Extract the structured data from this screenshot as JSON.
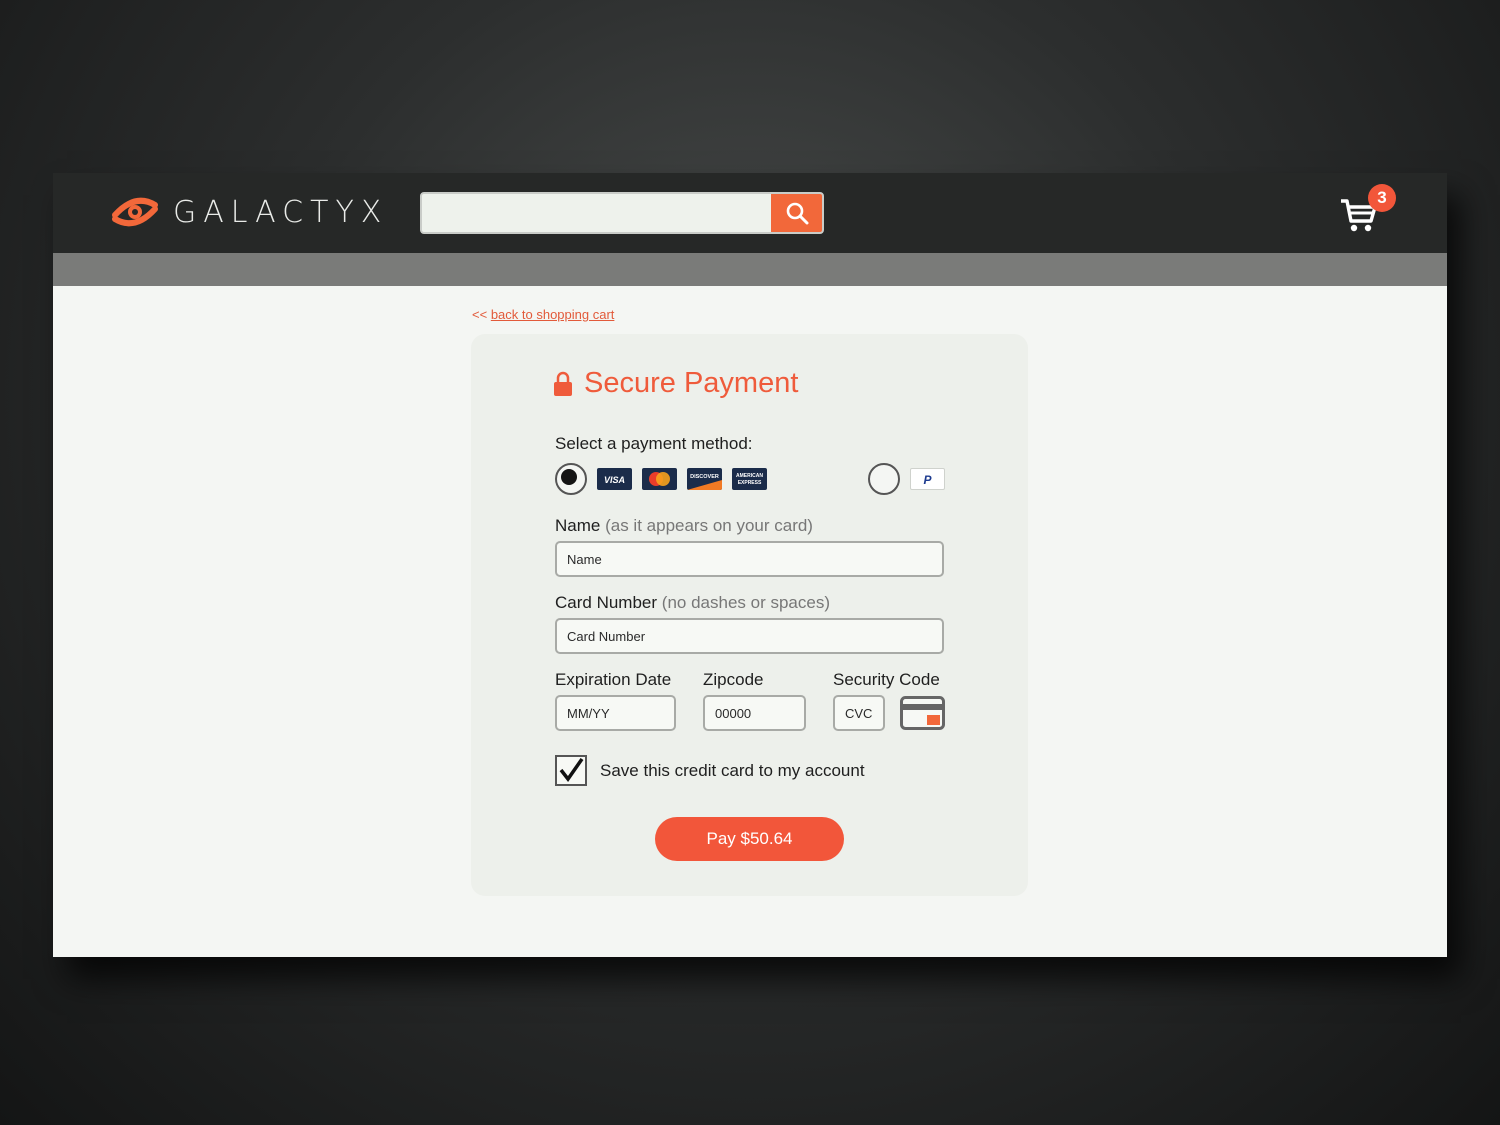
{
  "brand": {
    "name": "GALACTYX",
    "accent": "#f2683a"
  },
  "header": {
    "search_placeholder": "",
    "cart_count": "3"
  },
  "back_link": {
    "prefix": "<<",
    "text": "back to shopping cart"
  },
  "payment": {
    "title": "Secure Payment",
    "method_label": "Select a payment method:",
    "methods": {
      "cards": [
        "VISA",
        "Mastercard",
        "DISCOVER",
        "AMERICAN EXPRESS"
      ],
      "alt": "PayPal",
      "selected": "cards"
    },
    "name_label": "Name",
    "name_hint": "(as it appears on your card)",
    "name_placeholder": "Name",
    "card_label": "Card Number",
    "card_hint": "(no dashes or spaces)",
    "card_placeholder": "Card Number",
    "exp_label": "Expiration Date",
    "exp_placeholder": "MM/YY",
    "zip_label": "Zipcode",
    "zip_placeholder": "00000",
    "cvc_label": "Security Code",
    "cvc_placeholder": "CVC",
    "save_label": "Save this credit card to my account",
    "save_checked": true,
    "pay_label": "Pay $50.64"
  }
}
